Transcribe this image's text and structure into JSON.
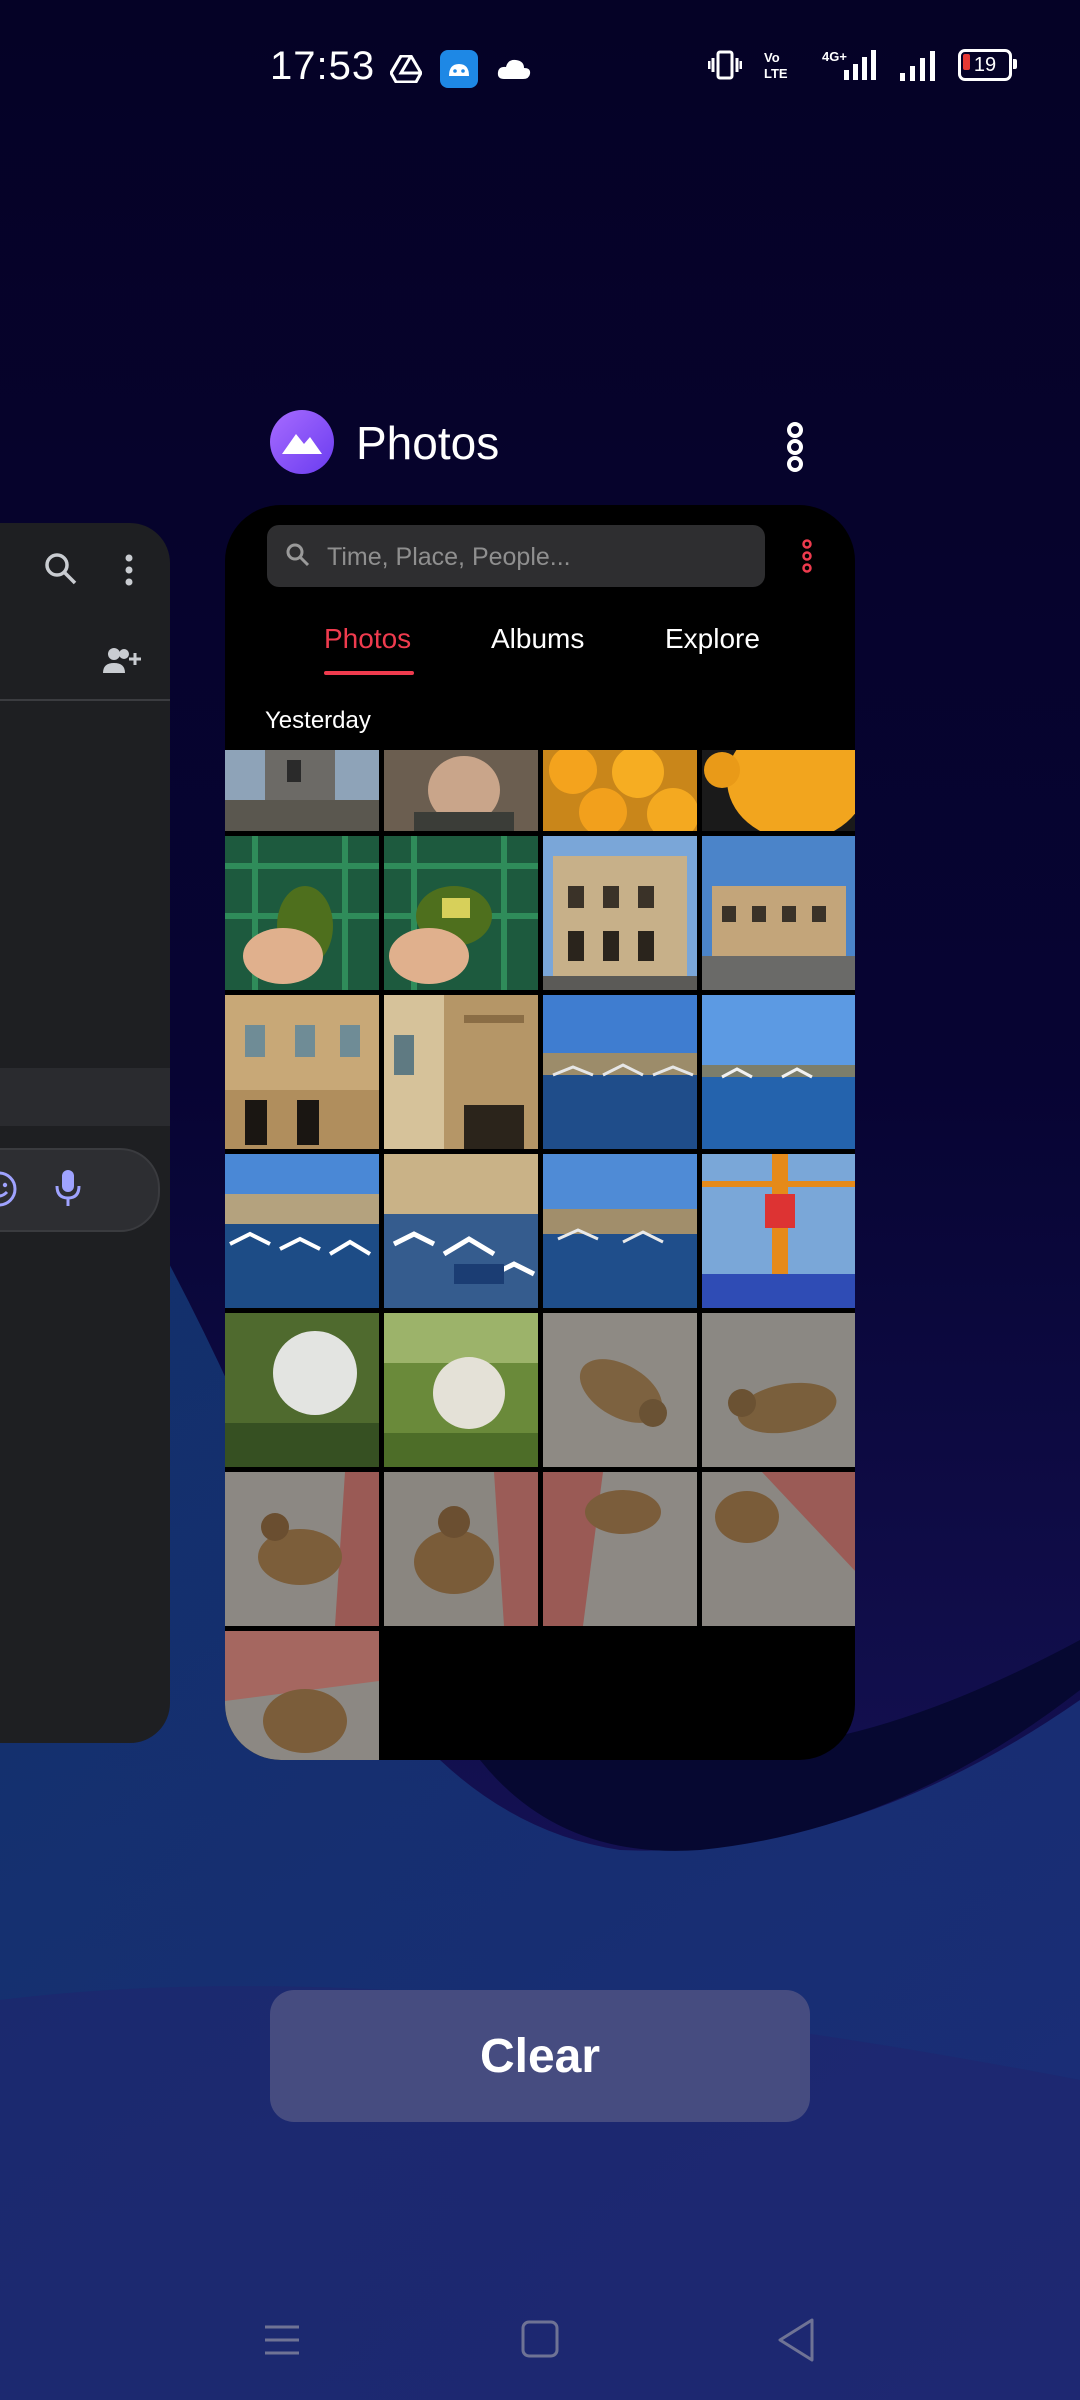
{
  "status_bar": {
    "time": "17:53",
    "notification_icons": [
      "drive-icon",
      "android-icon",
      "cloud-icon"
    ],
    "right_icons": [
      "vibrate-icon",
      "volte-icon",
      "4g-icon",
      "signal-icon",
      "signal-icon"
    ],
    "volte_label": "Vo\nLTE",
    "network_label": "4G+",
    "battery_level": "19"
  },
  "recents": {
    "app_title": "Photos",
    "clear_label": "Clear"
  },
  "photos_app": {
    "search_placeholder": "Time, Place, People...",
    "tabs": [
      {
        "label": "Photos",
        "active": true
      },
      {
        "label": "Albums",
        "active": false
      },
      {
        "label": "Explore",
        "active": false
      }
    ],
    "section_label": "Yesterday",
    "accent_color": "#ef3b4e"
  },
  "left_card": {
    "icons": [
      "search-icon",
      "more-vertical-icon",
      "add-person-icon",
      "emoji-icon",
      "mic-icon"
    ]
  },
  "nav_bar": {
    "buttons": [
      "menu-icon",
      "home-icon",
      "back-icon"
    ]
  }
}
